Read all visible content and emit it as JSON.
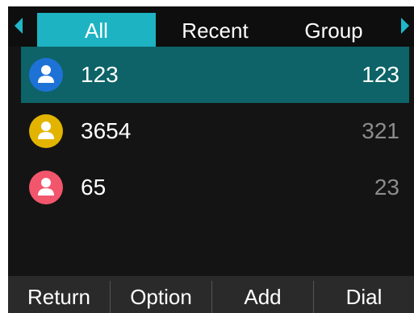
{
  "tabs": [
    {
      "label": "All",
      "active": true
    },
    {
      "label": "Recent",
      "active": false
    },
    {
      "label": "Group",
      "active": false
    }
  ],
  "contacts": [
    {
      "name": "123",
      "number": "123",
      "avatar_color": "#1e72d6",
      "selected": true
    },
    {
      "name": "3654",
      "number": "321",
      "avatar_color": "#e2b400",
      "selected": false
    },
    {
      "name": "65",
      "number": "23",
      "avatar_color": "#f2566c",
      "selected": false
    }
  ],
  "softkeys": {
    "return_label": "Return",
    "option_label": "Option",
    "add_label": "Add",
    "dial_label": "Dial"
  },
  "colors": {
    "accent": "#1db3c2",
    "selected_row": "#0d6367",
    "background": "#141414"
  },
  "icons": {
    "tab_left": "triangle-left-icon",
    "tab_right": "triangle-right-icon",
    "contact": "person-icon"
  }
}
